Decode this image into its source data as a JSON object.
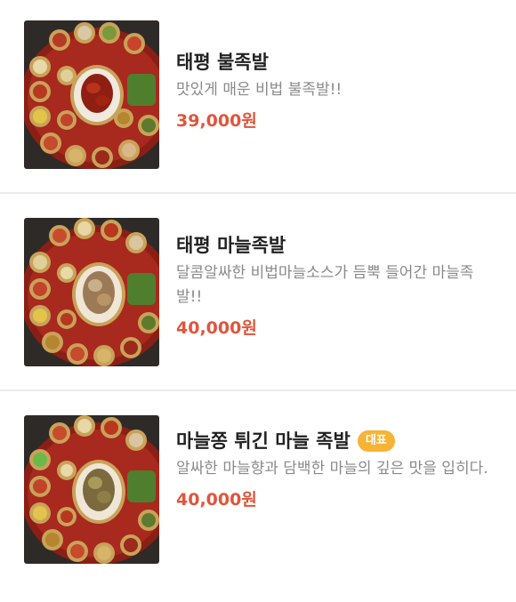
{
  "menu": {
    "items": [
      {
        "name": "태평 불족발",
        "description": "맛있게 매운 비법 불족발!!",
        "price": "39,000원",
        "badge": "",
        "image_icon": "spicy-jokbal-platter-image"
      },
      {
        "name": "태평 마늘족발",
        "description": "달콤알싸한 비법마늘소스가 듬뿍 들어간 마늘족발!!",
        "price": "40,000원",
        "badge": "",
        "image_icon": "garlic-jokbal-platter-image"
      },
      {
        "name": "마늘쫑 튀긴 마늘 족발",
        "description": "알싸한 마늘향과 담백한 마늘의 깊은 맛을 입히다.",
        "price": "40,000원",
        "badge": "대표",
        "image_icon": "fried-garlic-jokbal-platter-image"
      }
    ]
  },
  "colors": {
    "price": "#e0553c",
    "badge": "#f6b335",
    "title": "#222222",
    "description": "#8a8a8a",
    "divider": "#ececec"
  }
}
